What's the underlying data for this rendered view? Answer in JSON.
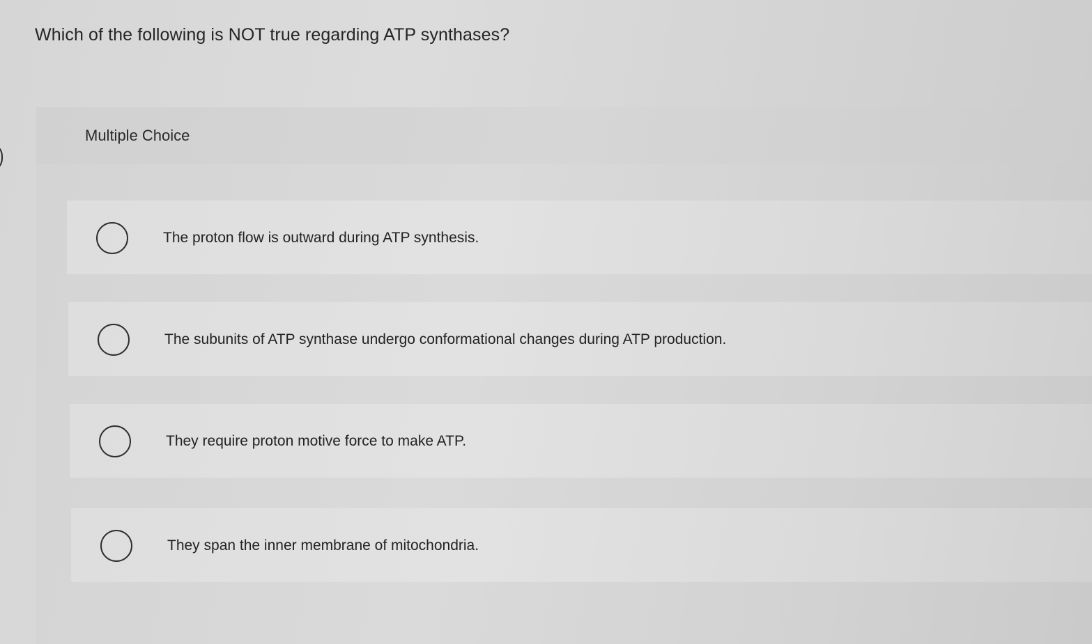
{
  "question": {
    "text": "Which of the following is NOT true regarding ATP synthases?"
  },
  "panel": {
    "label": "Multiple Choice"
  },
  "options": [
    {
      "text": "The proton flow is outward during ATP synthesis.",
      "selected": false
    },
    {
      "text": "The subunits of ATP synthase undergo conformational changes during ATP production.",
      "selected": false
    },
    {
      "text": "They require proton motive force to make ATP.",
      "selected": false
    },
    {
      "text": "They span the inner membrane of mitochondria.",
      "selected": false
    }
  ]
}
